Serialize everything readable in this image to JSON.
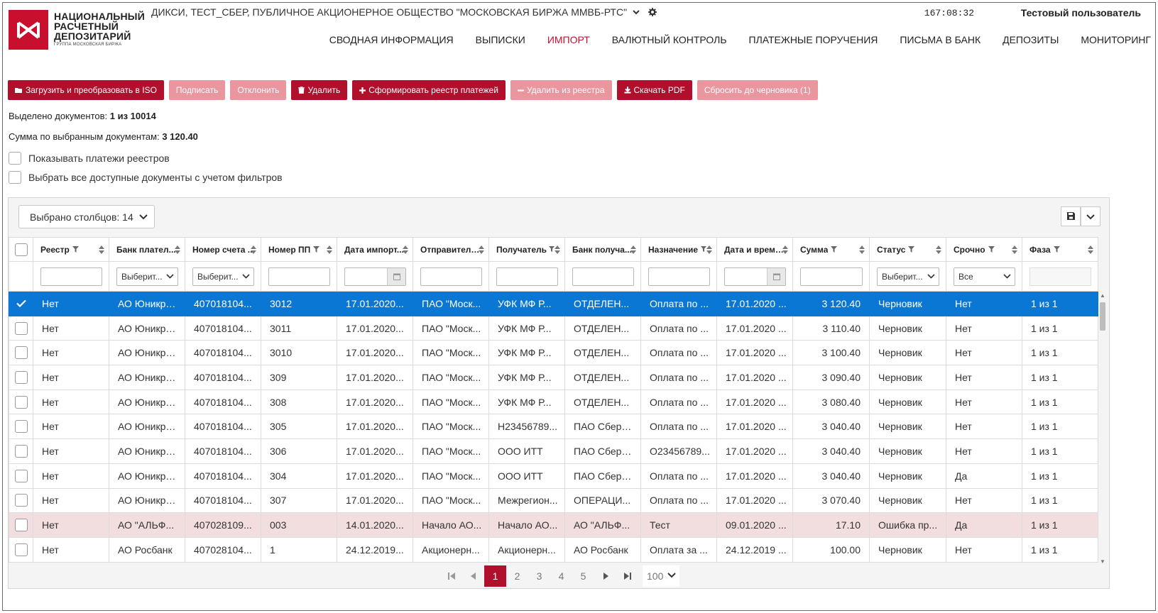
{
  "header": {
    "logo_lines": [
      "НАЦИОНАЛЬНЫЙ",
      "РАСЧЕТНЫЙ",
      "ДЕПОЗИТАРИЙ"
    ],
    "logo_sub": "ГРУППА МОСКОВСКАЯ БИРЖА",
    "org": "ДИКСИ, ТЕСТ_СБЕР, ПУБЛИЧНОЕ АКЦИОНЕРНОЕ ОБЩЕСТВО \"МОСКОВСКАЯ БИРЖА ММВБ-РТС\"",
    "clock": "167:08:32",
    "user": "Тестовый пользователь",
    "nav": [
      "СВОДНАЯ ИНФОРМАЦИЯ",
      "ВЫПИСКИ",
      "ИМПОРТ",
      "ВАЛЮТНЫЙ КОНТРОЛЬ",
      "ПЛАТЕЖНЫЕ ПОРУЧЕНИЯ",
      "ПИСЬМА В БАНК",
      "ДЕПОЗИТЫ",
      "МОНИТОРИНГ"
    ],
    "active_nav": "ИМПОРТ",
    "accent_color": "#c8102e"
  },
  "toolbar": {
    "upload": "Загрузить и преобразовать в ISO",
    "sign": "Подписать",
    "reject": "Отклонить",
    "delete": "Удалить",
    "form_registry": "Сформировать реестр платежей",
    "remove_from_registry": "Удалить из реестра",
    "download_pdf": "Скачать PDF",
    "reset_draft": "Сбросить до черновика (1)"
  },
  "info": {
    "selected_label": "Выделено документов:",
    "selected_value": "1 из 10014",
    "sum_label": "Сумма по выбранным документам:",
    "sum_value": "3 120.40",
    "show_registry_payments": "Показывать платежи реестров",
    "select_all_filtered": "Выбрать все доступные документы с учетом фильтров"
  },
  "grid": {
    "columns_selected": "Выбрано столбцов: 14",
    "headers": [
      "Реестр",
      "Банк плател...",
      "Номер счета ...",
      "Номер ПП",
      "Дата импорт...",
      "Отправитель...",
      "Получатель",
      "Банк получа...",
      "Назначение",
      "Дата и время...",
      "Сумма",
      "Статус",
      "Срочно",
      "Фаза"
    ],
    "filters": {
      "select_placeholder": "Выберит...",
      "urgent_default": "Все"
    },
    "rows": [
      [
        "Нет",
        "АО Юникре...",
        "407018104...",
        "3012",
        "17.01.2020...",
        "ПАО \"Моск...",
        "УФК МФ Р...",
        "ОТДЕЛЕН...",
        "Оплата по ...",
        "17.01.2020 ...",
        "3 120.40",
        "Черновик",
        "Нет",
        "1 из 1"
      ],
      [
        "Нет",
        "АО Юникре...",
        "407018104...",
        "3011",
        "17.01.2020...",
        "ПАО \"Моск...",
        "УФК МФ Р...",
        "ОТДЕЛЕН...",
        "Оплата по ...",
        "17.01.2020 ...",
        "3 110.40",
        "Черновик",
        "Нет",
        "1 из 1"
      ],
      [
        "Нет",
        "АО Юникре...",
        "407018104...",
        "3010",
        "17.01.2020...",
        "ПАО \"Моск...",
        "УФК МФ Р...",
        "ОТДЕЛЕН...",
        "Оплата по ...",
        "17.01.2020 ...",
        "3 100.40",
        "Черновик",
        "Нет",
        "1 из 1"
      ],
      [
        "Нет",
        "АО Юникре...",
        "407018104...",
        "309",
        "17.01.2020...",
        "ПАО \"Моск...",
        "УФК МФ Р...",
        "ОТДЕЛЕН...",
        "Оплата по ...",
        "17.01.2020 ...",
        "3 090.40",
        "Черновик",
        "Нет",
        "1 из 1"
      ],
      [
        "Нет",
        "АО Юникре...",
        "407018104...",
        "308",
        "17.01.2020...",
        "ПАО \"Моск...",
        "УФК МФ Р...",
        "ОТДЕЛЕН...",
        "Оплата по ...",
        "17.01.2020 ...",
        "3 080.40",
        "Черновик",
        "Нет",
        "1 из 1"
      ],
      [
        "Нет",
        "АО Юникре...",
        "407018104...",
        "305",
        "17.01.2020...",
        "ПАО \"Моск...",
        "Н23456789...",
        "ПАО Сберб...",
        "Оплата по ...",
        "17.01.2020 ...",
        "3 040.40",
        "Черновик",
        "Нет",
        "1 из 1"
      ],
      [
        "Нет",
        "АО Юникре...",
        "407018104...",
        "306",
        "17.01.2020...",
        "ПАО \"Моск...",
        "ООО ИТТ",
        "ПАО Сберб...",
        "О23456789...",
        "17.01.2020 ...",
        "3 040.40",
        "Черновик",
        "Нет",
        "1 из 1"
      ],
      [
        "Нет",
        "АО Юникре...",
        "407018104...",
        "304",
        "17.01.2020...",
        "ПАО \"Моск...",
        "ООО ИТТ",
        "ПАО Сберб...",
        "Оплата по ...",
        "17.01.2020 ...",
        "3 040.40",
        "Черновик",
        "Да",
        "1 из 1"
      ],
      [
        "Нет",
        "АО Юникре...",
        "407018104...",
        "307",
        "17.01.2020...",
        "ПАО \"Моск...",
        "Межрегион...",
        "ОПЕРАЦИ...",
        "Оплата по ...",
        "17.01.2020 ...",
        "3 070.40",
        "Черновик",
        "Нет",
        "1 из 1"
      ],
      [
        "Нет",
        "АО \"АЛЬФ...",
        "407028109...",
        "003",
        "14.01.2020...",
        "Начало АО...",
        "Начало АО...",
        "АО \"АЛЬФ...",
        "Тест",
        "09.01.2020 ...",
        "17.10",
        "Ошибка пр...",
        "Да",
        "1 из 1"
      ],
      [
        "Нет",
        "АО Росбанк",
        "407028104...",
        "1",
        "24.12.2019...",
        "Акционерн...",
        "Акционерн...",
        "АО Росбанк",
        "Оплата за ...",
        "24.12.2019 ...",
        "100.00",
        "Черновик",
        "Нет",
        "1 из 1"
      ]
    ],
    "selected_row": 0,
    "error_row": 9,
    "selected_color": "#0a77d5",
    "error_color": "#f2dedf"
  },
  "pager": {
    "pages": [
      "1",
      "2",
      "3",
      "4",
      "5"
    ],
    "active_page": "1",
    "page_size": "100"
  }
}
